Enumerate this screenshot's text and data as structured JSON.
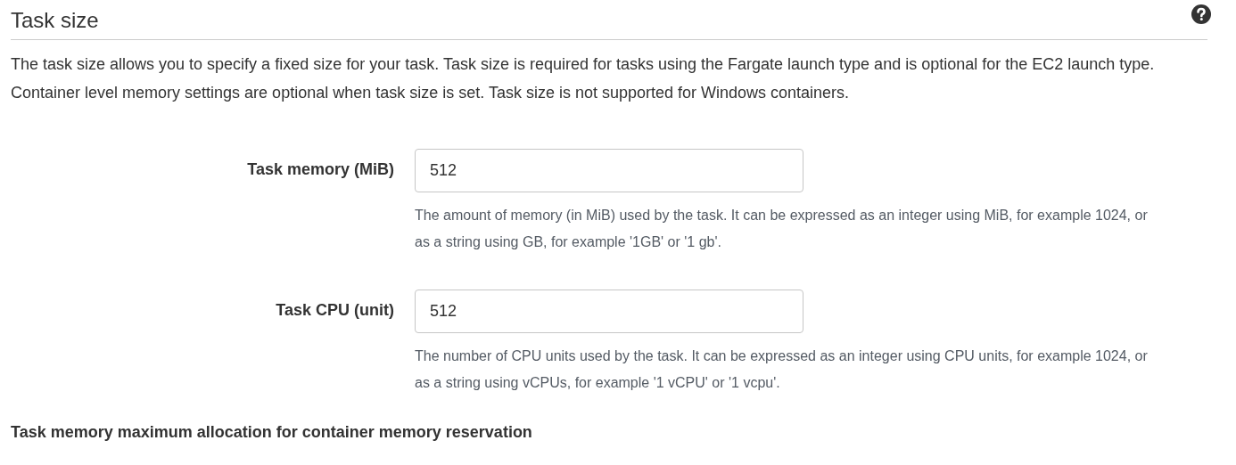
{
  "section": {
    "title": "Task size",
    "description": "The task size allows you to specify a fixed size for your task. Task size is required for tasks using the Fargate launch type and is optional for the EC2 launch type. Container level memory settings are optional when task size is set. Task size is not supported for Windows containers."
  },
  "fields": [
    {
      "label": "Task memory (MiB)",
      "value": "512",
      "help": "The amount of memory (in MiB) used by the task. It can be expressed as an integer using MiB, for example 1024, or as a string using GB, for example '1GB' or '1 gb'."
    },
    {
      "label": "Task CPU (unit)",
      "value": "512",
      "help": "The number of CPU units used by the task. It can be expressed as an integer using CPU units, for example 1024, or as a string using vCPUs, for example '1 vCPU' or '1 vcpu'."
    }
  ],
  "subsection": {
    "title": "Task memory maximum allocation for container memory reservation"
  }
}
